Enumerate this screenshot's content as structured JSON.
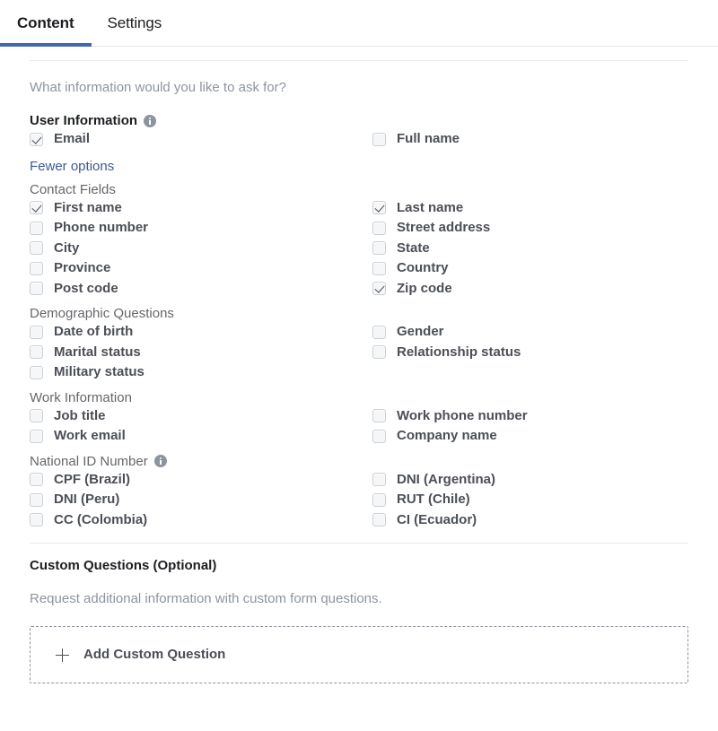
{
  "tabs": [
    {
      "label": "Content",
      "active": true
    },
    {
      "label": "Settings",
      "active": false
    }
  ],
  "lead_question": "What information would you like to ask for?",
  "colors": {
    "accent": "#4267b2",
    "link": "#3b5998",
    "label": "#4b4f56",
    "muted": "#8d949e",
    "heading": "#1c1e21",
    "divider": "#e9ebee",
    "checkbox_bg": "#f5f6f7",
    "checkbox_border": "#ccd0d5"
  },
  "user_information": {
    "title": "User Information",
    "has_info_icon": true,
    "rows": [
      [
        {
          "label": "Email",
          "checked": true
        },
        {
          "label": "Full name",
          "checked": false
        }
      ]
    ],
    "toggle_link": "Fewer options"
  },
  "groups": [
    {
      "title": "Contact Fields",
      "has_info_icon": false,
      "rows": [
        [
          {
            "label": "First name",
            "checked": true
          },
          {
            "label": "Last name",
            "checked": true
          }
        ],
        [
          {
            "label": "Phone number",
            "checked": false
          },
          {
            "label": "Street address",
            "checked": false
          }
        ],
        [
          {
            "label": "City",
            "checked": false
          },
          {
            "label": "State",
            "checked": false
          }
        ],
        [
          {
            "label": "Province",
            "checked": false
          },
          {
            "label": "Country",
            "checked": false
          }
        ],
        [
          {
            "label": "Post code",
            "checked": false
          },
          {
            "label": "Zip code",
            "checked": true
          }
        ]
      ]
    },
    {
      "title": "Demographic Questions",
      "has_info_icon": false,
      "rows": [
        [
          {
            "label": "Date of birth",
            "checked": false
          },
          {
            "label": "Gender",
            "checked": false
          }
        ],
        [
          {
            "label": "Marital status",
            "checked": false
          },
          {
            "label": "Relationship status",
            "checked": false
          }
        ],
        [
          {
            "label": "Military status",
            "checked": false
          },
          null
        ]
      ]
    },
    {
      "title": "Work Information",
      "has_info_icon": false,
      "rows": [
        [
          {
            "label": "Job title",
            "checked": false
          },
          {
            "label": "Work phone number",
            "checked": false
          }
        ],
        [
          {
            "label": "Work email",
            "checked": false
          },
          {
            "label": "Company name",
            "checked": false
          }
        ]
      ]
    },
    {
      "title": "National ID Number",
      "has_info_icon": true,
      "rows": [
        [
          {
            "label": "CPF (Brazil)",
            "checked": false
          },
          {
            "label": "DNI (Argentina)",
            "checked": false
          }
        ],
        [
          {
            "label": "DNI (Peru)",
            "checked": false
          },
          {
            "label": "RUT (Chile)",
            "checked": false
          }
        ],
        [
          {
            "label": "CC (Colombia)",
            "checked": false
          },
          {
            "label": "CI (Ecuador)",
            "checked": false
          }
        ]
      ]
    }
  ],
  "custom_questions": {
    "title": "Custom Questions (Optional)",
    "description": "Request additional information with custom form questions.",
    "add_button_label": "Add Custom Question",
    "add_button_icon": "plus-icon"
  }
}
